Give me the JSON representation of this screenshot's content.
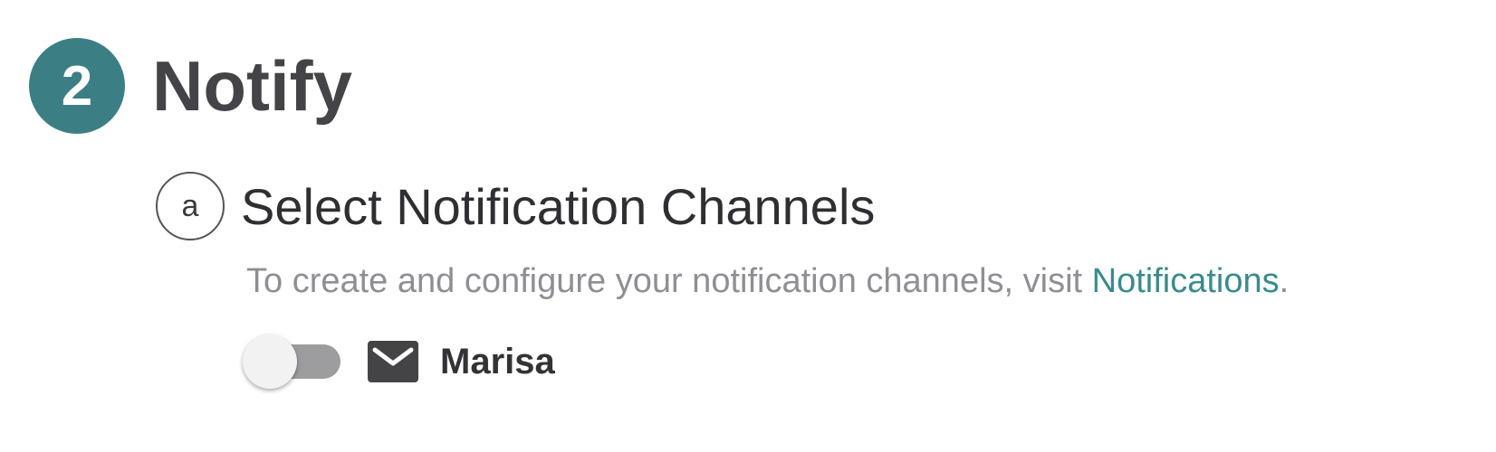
{
  "step": {
    "number": "2",
    "title": "Notify",
    "badge_color": "#3b7f85"
  },
  "substep": {
    "letter": "a",
    "title": "Select Notification Channels"
  },
  "description": {
    "text_before": "To create and configure your notification channels, visit ",
    "link_text": "Notifications",
    "text_after": ".",
    "link_color": "#3a8b8b"
  },
  "channels": [
    {
      "name": "Marisa",
      "icon": "mail-icon",
      "enabled": false
    }
  ]
}
